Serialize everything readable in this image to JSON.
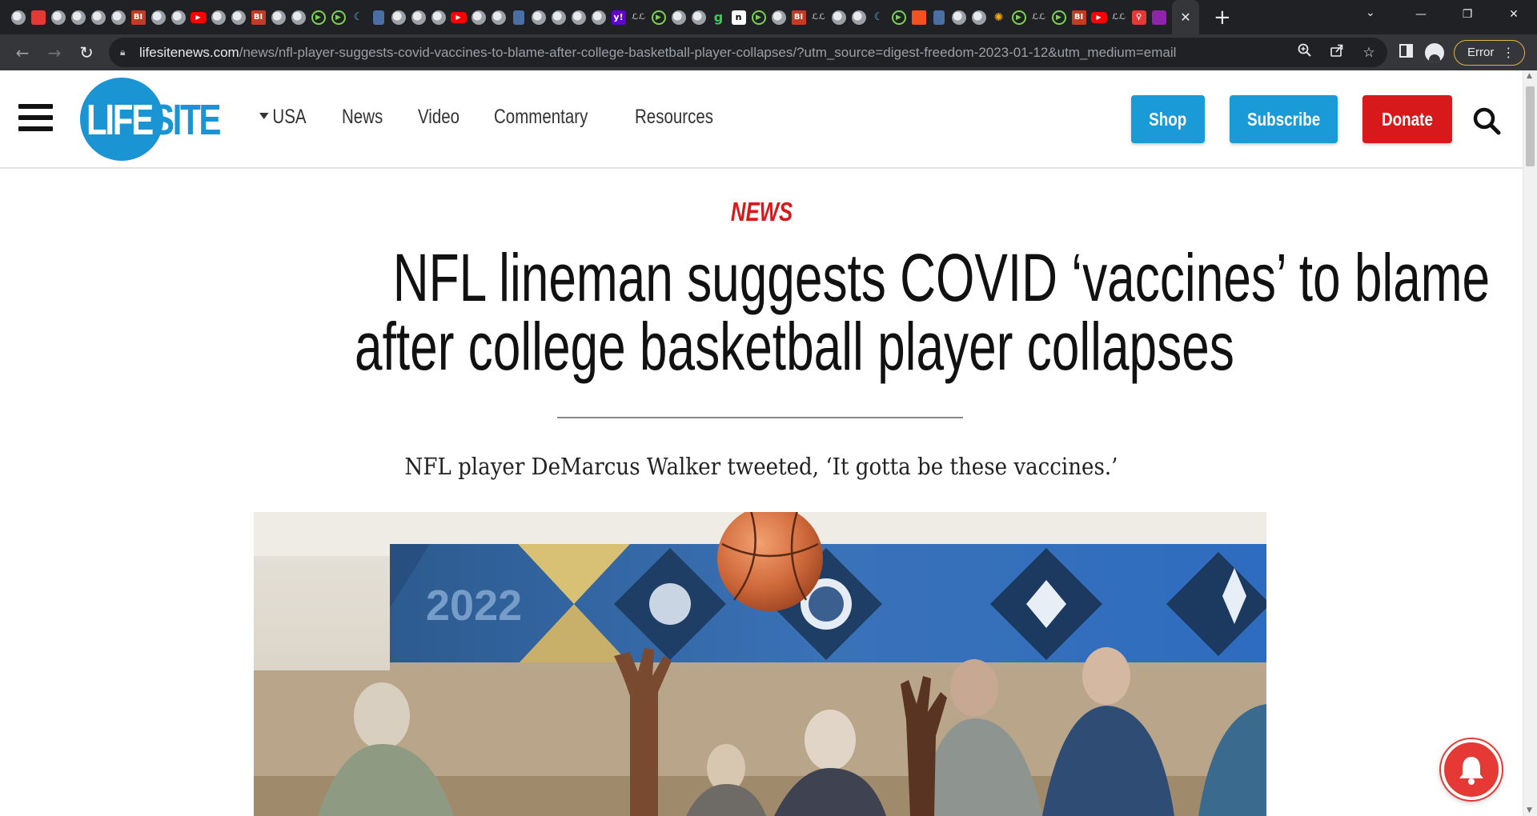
{
  "browser": {
    "tabs": [
      {
        "icon": "globe"
      },
      {
        "icon": "colorful"
      },
      {
        "icon": "globe"
      },
      {
        "icon": "globe"
      },
      {
        "icon": "globe"
      },
      {
        "icon": "globe"
      },
      {
        "icon": "bi",
        "text": "BI"
      },
      {
        "icon": "globe"
      },
      {
        "icon": "globe"
      },
      {
        "icon": "yt",
        "text": "▶"
      },
      {
        "icon": "globe"
      },
      {
        "icon": "globe"
      },
      {
        "icon": "bi",
        "text": "BI"
      },
      {
        "icon": "globe"
      },
      {
        "icon": "globe"
      },
      {
        "icon": "play",
        "text": "▶"
      },
      {
        "icon": "play",
        "text": "▶"
      },
      {
        "icon": "ch",
        "text": "☾"
      },
      {
        "icon": "bm"
      },
      {
        "icon": "globe"
      },
      {
        "icon": "globe"
      },
      {
        "icon": "globe"
      },
      {
        "icon": "yt",
        "text": "▶"
      },
      {
        "icon": "globe"
      },
      {
        "icon": "globe"
      },
      {
        "icon": "bm"
      },
      {
        "icon": "globe"
      },
      {
        "icon": "globe"
      },
      {
        "icon": "globe"
      },
      {
        "icon": "globe"
      },
      {
        "icon": "yh",
        "text": "y!"
      },
      {
        "icon": "cz",
        "text": "ℒℒ"
      },
      {
        "icon": "play",
        "text": "▶"
      },
      {
        "icon": "globe"
      },
      {
        "icon": "globe"
      },
      {
        "icon": "g",
        "text": "g"
      },
      {
        "icon": "n",
        "text": "n"
      },
      {
        "icon": "play",
        "text": "▶"
      },
      {
        "icon": "globe"
      },
      {
        "icon": "bi",
        "text": "BI"
      },
      {
        "icon": "cz",
        "text": "ℒℒ"
      },
      {
        "icon": "globe"
      },
      {
        "icon": "globe"
      },
      {
        "icon": "ch",
        "text": "☾"
      },
      {
        "icon": "play",
        "text": "▶"
      },
      {
        "icon": "bar"
      },
      {
        "icon": "bm"
      },
      {
        "icon": "globe"
      },
      {
        "icon": "globe"
      },
      {
        "icon": "sun",
        "text": "✺"
      },
      {
        "icon": "play",
        "text": "▶"
      },
      {
        "icon": "cz",
        "text": "ℒℒ"
      },
      {
        "icon": "play",
        "text": "▶"
      },
      {
        "icon": "bi",
        "text": "BI"
      },
      {
        "icon": "yt",
        "text": "▶"
      },
      {
        "icon": "cz",
        "text": "ℒℒ"
      },
      {
        "icon": "pin",
        "text": "♀"
      },
      {
        "icon": "purple"
      }
    ],
    "active_tab_close": "✕",
    "new_tab": "+",
    "tab_search": "⌄",
    "window_controls": {
      "minimize": "—",
      "restore": "❐",
      "close": "✕"
    },
    "url_host": "lifesitenews.com",
    "url_path": "/news/nfl-player-suggests-covid-vaccines-to-blame-after-college-basketball-player-collapses/?utm_source=digest-freedom-2023-01-12&utm_medium=email",
    "error_label": "Error"
  },
  "site": {
    "logo_life": "LIFE",
    "logo_site": "SITE",
    "region": "USA",
    "nav": [
      "News",
      "Video",
      "Commentary",
      "Resources"
    ],
    "shop": "Shop",
    "subscribe": "Subscribe",
    "donate": "Donate",
    "brand_blue": "#1a94d2",
    "brand_red": "#d7191b"
  },
  "article": {
    "kicker": "NEWS",
    "headline_line1": "NFL lineman suggests COVID ‘vaccines’ to blame",
    "headline_line2": "after college basketball player collapses",
    "subtitle": "NFL player DeMarcus Walker tweeted, ‘It gotta be these vaccines.’",
    "banner_year": "2022"
  }
}
